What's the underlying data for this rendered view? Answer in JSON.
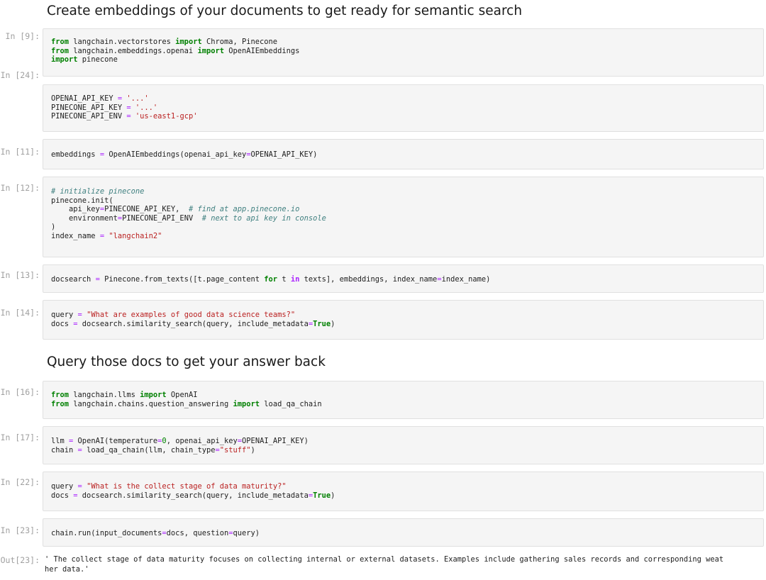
{
  "headings": {
    "h1": "Create embeddings of your documents to get ready for semantic search",
    "h2": "Query those docs to get your answer back"
  },
  "cells": [
    {
      "prompt": "In [9]:",
      "lines": [
        [
          [
            "from",
            "kw"
          ],
          [
            " langchain.vectorstores ",
            ""
          ],
          [
            "import",
            "kw"
          ],
          [
            " Chroma, Pinecone",
            ""
          ]
        ],
        [
          [
            "from",
            "kw"
          ],
          [
            " langchain.embeddings.openai ",
            ""
          ],
          [
            "import",
            "kw"
          ],
          [
            " OpenAIEmbeddings",
            ""
          ]
        ],
        [
          [
            "import",
            "kw"
          ],
          [
            " pinecone",
            ""
          ]
        ]
      ]
    },
    {
      "prompt": "In [24]:",
      "lines": [
        [
          [
            "OPENAI_API_KEY ",
            ""
          ],
          [
            "=",
            "op"
          ],
          [
            " ",
            ""
          ],
          [
            "'...'",
            "str"
          ]
        ],
        [
          [
            "PINECONE_API_KEY ",
            ""
          ],
          [
            "=",
            "op"
          ],
          [
            " ",
            ""
          ],
          [
            "'...'",
            "str"
          ]
        ],
        [
          [
            "PINECONE_API_ENV ",
            ""
          ],
          [
            "=",
            "op"
          ],
          [
            " ",
            ""
          ],
          [
            "'us-east1-gcp'",
            "str"
          ]
        ]
      ]
    },
    {
      "prompt": "In [11]:",
      "lines": [
        [
          [
            "embeddings ",
            ""
          ],
          [
            "=",
            "op"
          ],
          [
            " OpenAIEmbeddings(openai_api_key",
            ""
          ],
          [
            "=",
            "op"
          ],
          [
            "OPENAI_API_KEY)",
            ""
          ]
        ]
      ]
    },
    {
      "prompt": "In [12]:",
      "lines": [
        [
          [
            "# initialize pinecone",
            "cm"
          ]
        ],
        [
          [
            "pinecone.init(",
            ""
          ]
        ],
        [
          [
            "    api_key",
            ""
          ],
          [
            "=",
            "op"
          ],
          [
            "PINECONE_API_KEY,  ",
            ""
          ],
          [
            "# find at app.pinecone.io",
            "cm"
          ]
        ],
        [
          [
            "    environment",
            ""
          ],
          [
            "=",
            "op"
          ],
          [
            "PINECONE_API_ENV  ",
            ""
          ],
          [
            "# next to api key in console",
            "cm"
          ]
        ],
        [
          [
            ")",
            ""
          ]
        ],
        [
          [
            "index_name ",
            ""
          ],
          [
            "=",
            "op"
          ],
          [
            " ",
            ""
          ],
          [
            "\"langchain2\"",
            "str"
          ]
        ]
      ]
    },
    {
      "prompt": "In [13]:",
      "lines": [
        [
          [
            "docsearch ",
            ""
          ],
          [
            "=",
            "op"
          ],
          [
            " Pinecone.from_texts([t.page_content ",
            ""
          ],
          [
            "for",
            "kw"
          ],
          [
            " t ",
            ""
          ],
          [
            "in",
            "kwp"
          ],
          [
            " texts], embeddings, index_name",
            ""
          ],
          [
            "=",
            "op"
          ],
          [
            "index_name)",
            ""
          ]
        ]
      ]
    },
    {
      "prompt": "In [14]:",
      "lines": [
        [
          [
            "query ",
            ""
          ],
          [
            "=",
            "op"
          ],
          [
            " ",
            ""
          ],
          [
            "\"What are examples of good data science teams?\"",
            "str"
          ]
        ],
        [
          [
            "docs ",
            ""
          ],
          [
            "=",
            "op"
          ],
          [
            " docsearch.similarity_search(query, include_metadata",
            ""
          ],
          [
            "=",
            "op"
          ],
          [
            "True",
            "bool"
          ],
          [
            ")",
            ""
          ]
        ]
      ]
    },
    {
      "prompt": "In [16]:",
      "lines": [
        [
          [
            "from",
            "kw"
          ],
          [
            " langchain.llms ",
            ""
          ],
          [
            "import",
            "kw"
          ],
          [
            " OpenAI",
            ""
          ]
        ],
        [
          [
            "from",
            "kw"
          ],
          [
            " langchain.chains.question_answering ",
            ""
          ],
          [
            "import",
            "kw"
          ],
          [
            " load_qa_chain",
            ""
          ]
        ]
      ]
    },
    {
      "prompt": "In [17]:",
      "lines": [
        [
          [
            "llm ",
            ""
          ],
          [
            "=",
            "op"
          ],
          [
            " OpenAI(temperature",
            ""
          ],
          [
            "=",
            "op"
          ],
          [
            "0",
            "num"
          ],
          [
            ", openai_api_key",
            ""
          ],
          [
            "=",
            "op"
          ],
          [
            "OPENAI_API_KEY)",
            ""
          ]
        ],
        [
          [
            "chain ",
            ""
          ],
          [
            "=",
            "op"
          ],
          [
            " load_qa_chain(llm, chain_type",
            ""
          ],
          [
            "=",
            "op"
          ],
          [
            "\"stuff\"",
            "str"
          ],
          [
            ")",
            ""
          ]
        ]
      ]
    },
    {
      "prompt": "In [22]:",
      "lines": [
        [
          [
            "query ",
            ""
          ],
          [
            "=",
            "op"
          ],
          [
            " ",
            ""
          ],
          [
            "\"What is the collect stage of data maturity?\"",
            "str"
          ]
        ],
        [
          [
            "docs ",
            ""
          ],
          [
            "=",
            "op"
          ],
          [
            " docsearch.similarity_search(query, include_metadata",
            ""
          ],
          [
            "=",
            "op"
          ],
          [
            "True",
            "bool"
          ],
          [
            ")",
            ""
          ]
        ]
      ]
    },
    {
      "prompt": "In [23]:",
      "lines": [
        [
          [
            "chain.run(input_documents",
            ""
          ],
          [
            "=",
            "op"
          ],
          [
            "docs, question",
            ""
          ],
          [
            "=",
            "op"
          ],
          [
            "query)",
            ""
          ]
        ]
      ]
    }
  ],
  "output": {
    "prompt": "Out[23]:",
    "text": "' The collect stage of data maturity focuses on collecting internal or external datasets. Examples include gathering sales records and corresponding weat\nher data.'"
  }
}
